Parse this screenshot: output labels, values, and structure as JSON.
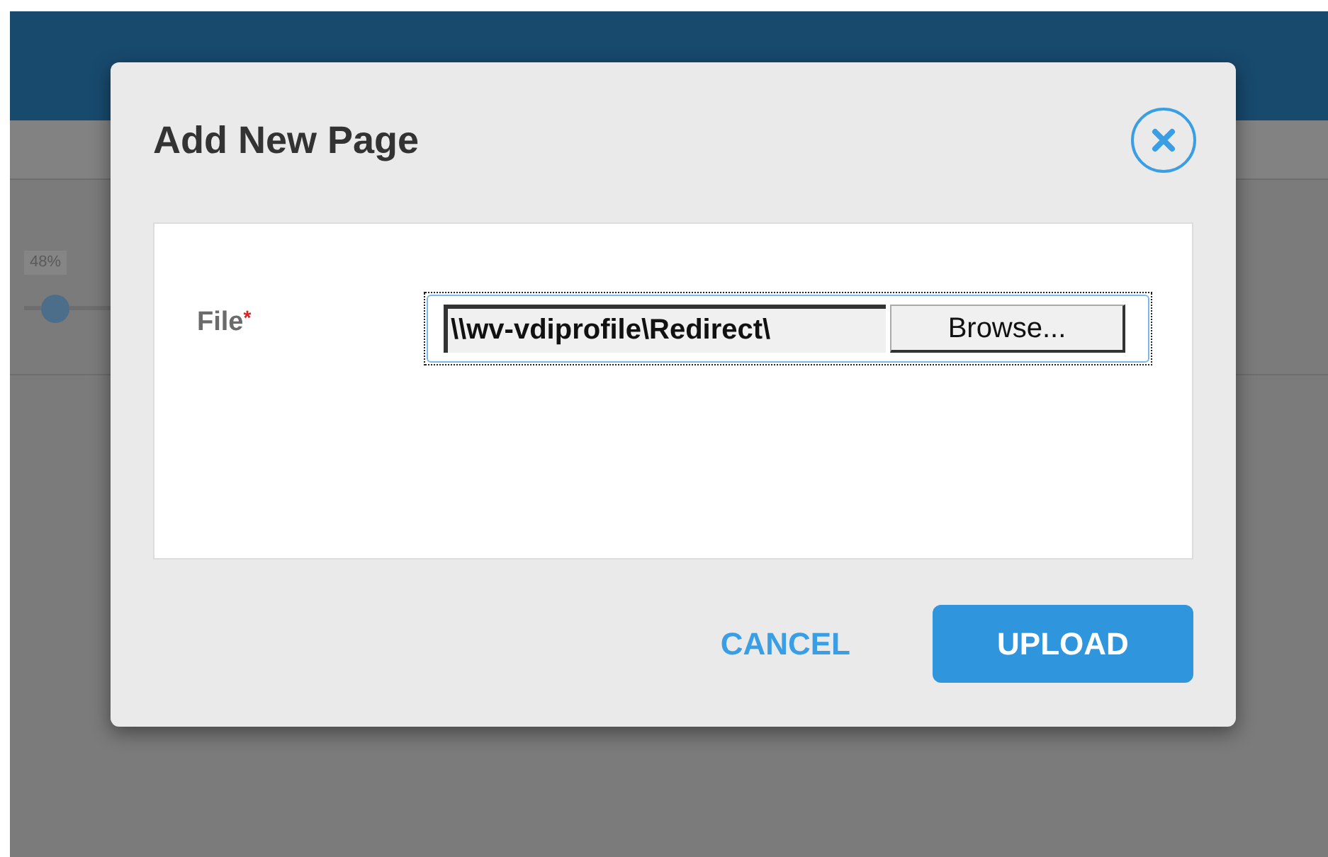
{
  "background": {
    "slider_reading": "48%"
  },
  "dialog": {
    "title": "Add New Page",
    "field": {
      "label": "File",
      "required_mark": "*",
      "value": "\\\\wv-vdiprofile\\Redirect\\",
      "button": "Browse..."
    },
    "buttons": [
      {
        "label": "CANCEL",
        "kind": "text"
      },
      {
        "label": "UPLOAD",
        "kind": "primary"
      }
    ]
  }
}
